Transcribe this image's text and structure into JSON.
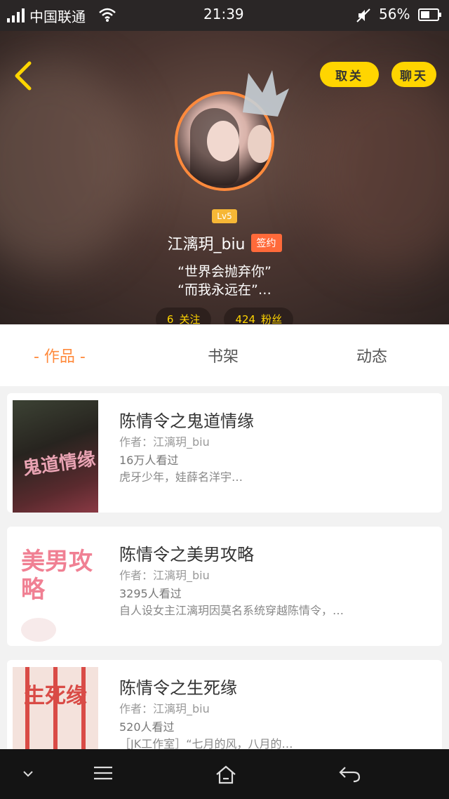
{
  "status_bar": {
    "carrier": "中国联通",
    "time": "21:39",
    "battery_pct": "56%",
    "battery_level": 0.56
  },
  "header": {
    "unfollow_label": "取关",
    "chat_label": "聊天",
    "level": "Lv5",
    "username": "江漓玥_biu",
    "signed_label": "签约",
    "bio_line1": "“世界会抛弃你”",
    "bio_line2": "“而我永远在”…",
    "following_count": "6",
    "following_label": "关注",
    "followers_count": "424",
    "followers_label": "粉丝"
  },
  "tabs": [
    {
      "label": "- 作品 -",
      "active": true
    },
    {
      "label": "书架",
      "active": false
    },
    {
      "label": "动态",
      "active": false
    }
  ],
  "works": [
    {
      "title": "陈情令之鬼道情缘",
      "author": "作者：江漓玥_biu",
      "views": "16万人看过",
      "desc": "虎牙少年，娃薛名洋宇…",
      "cover_text": "鬼道情缘"
    },
    {
      "title": "陈情令之美男攻略",
      "author": "作者：江漓玥_biu",
      "views": "3295人看过",
      "desc": "自人设女主江漓玥因莫名系统穿越陈情令，…",
      "cover_text": "美男攻略"
    },
    {
      "title": "陈情令之生死缘",
      "author": "作者：江漓玥_biu",
      "views": "520人看过",
      "desc": "［JK工作室］“七月的风，八月的…",
      "cover_text": "生死缘"
    }
  ],
  "accent_colors": {
    "orange": "#ff8a3c",
    "yellow": "#ffd500"
  }
}
